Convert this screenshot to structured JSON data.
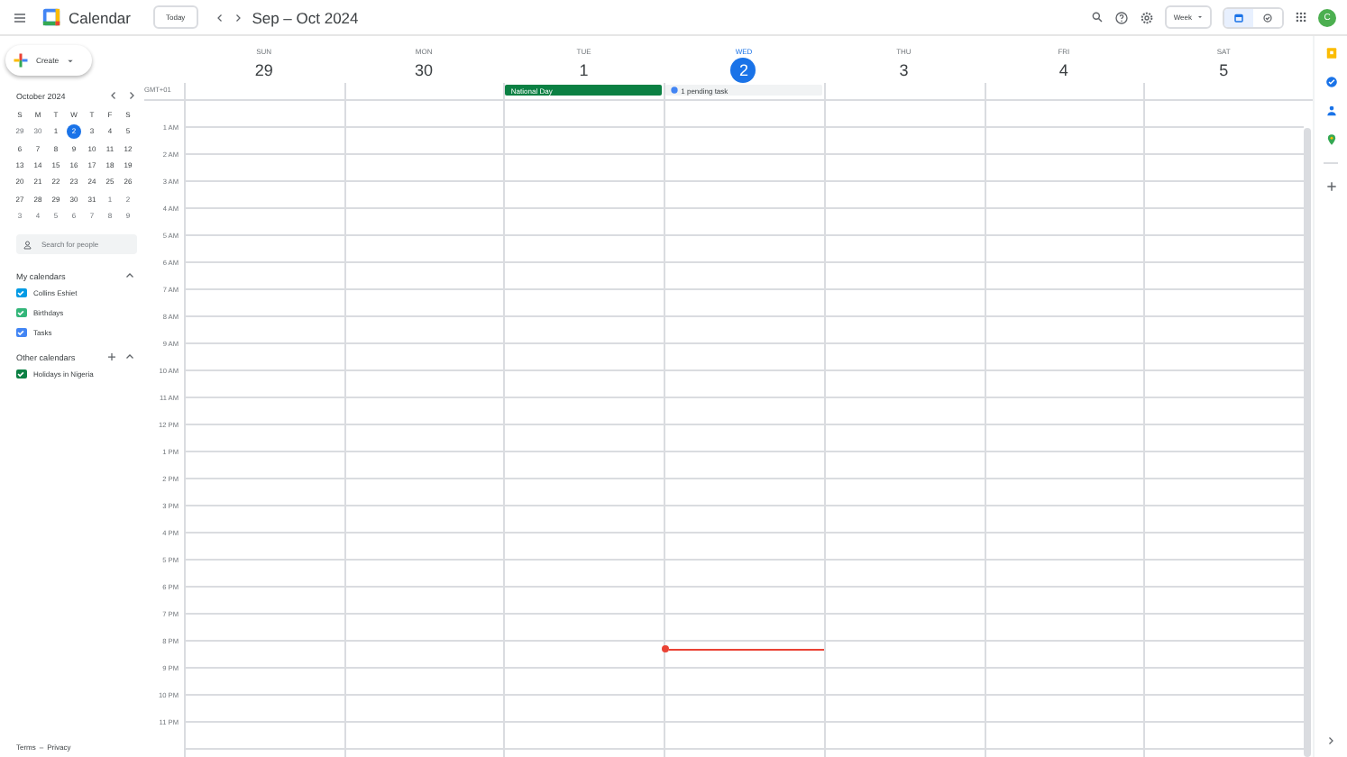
{
  "header": {
    "app_name": "Calendar",
    "today_button": "Today",
    "title": "Sep – Oct 2024",
    "view_select": "Week",
    "view_toggle": [
      {
        "kind": "calendar",
        "selected": true
      },
      {
        "kind": "tasks",
        "selected": false
      }
    ],
    "avatar": "C"
  },
  "sidebar": {
    "create_button": "Create",
    "mini_calendar": {
      "month": "October 2024",
      "weekdays": [
        "S",
        "M",
        "T",
        "W",
        "T",
        "F",
        "S"
      ],
      "weeks": [
        [
          {
            "day": "29",
            "other_month": true,
            "selected": false
          },
          {
            "day": "30",
            "other_month": true,
            "selected": false
          },
          {
            "day": "1",
            "other_month": false,
            "selected": false
          },
          {
            "day": "2",
            "other_month": false,
            "selected": true
          },
          {
            "day": "3",
            "other_month": false,
            "selected": false
          },
          {
            "day": "4",
            "other_month": false,
            "selected": false
          },
          {
            "day": "5",
            "other_month": false,
            "selected": false
          }
        ],
        [
          {
            "day": "6",
            "other_month": false,
            "selected": false
          },
          {
            "day": "7",
            "other_month": false,
            "selected": false
          },
          {
            "day": "8",
            "other_month": false,
            "selected": false
          },
          {
            "day": "9",
            "other_month": false,
            "selected": false
          },
          {
            "day": "10",
            "other_month": false,
            "selected": false
          },
          {
            "day": "11",
            "other_month": false,
            "selected": false
          },
          {
            "day": "12",
            "other_month": false,
            "selected": false
          }
        ],
        [
          {
            "day": "13",
            "other_month": false,
            "selected": false
          },
          {
            "day": "14",
            "other_month": false,
            "selected": false
          },
          {
            "day": "15",
            "other_month": false,
            "selected": false
          },
          {
            "day": "16",
            "other_month": false,
            "selected": false
          },
          {
            "day": "17",
            "other_month": false,
            "selected": false
          },
          {
            "day": "18",
            "other_month": false,
            "selected": false
          },
          {
            "day": "19",
            "other_month": false,
            "selected": false
          }
        ],
        [
          {
            "day": "20",
            "other_month": false,
            "selected": false
          },
          {
            "day": "21",
            "other_month": false,
            "selected": false
          },
          {
            "day": "22",
            "other_month": false,
            "selected": false
          },
          {
            "day": "23",
            "other_month": false,
            "selected": false
          },
          {
            "day": "24",
            "other_month": false,
            "selected": false
          },
          {
            "day": "25",
            "other_month": false,
            "selected": false
          },
          {
            "day": "26",
            "other_month": false,
            "selected": false
          }
        ],
        [
          {
            "day": "27",
            "other_month": false,
            "selected": false
          },
          {
            "day": "28",
            "other_month": false,
            "selected": false
          },
          {
            "day": "29",
            "other_month": false,
            "selected": false
          },
          {
            "day": "30",
            "other_month": false,
            "selected": false
          },
          {
            "day": "31",
            "other_month": false,
            "selected": false
          },
          {
            "day": "1",
            "other_month": true,
            "selected": false
          },
          {
            "day": "2",
            "other_month": true,
            "selected": false
          }
        ],
        [
          {
            "day": "3",
            "other_month": true,
            "selected": false
          },
          {
            "day": "4",
            "other_month": true,
            "selected": false
          },
          {
            "day": "5",
            "other_month": true,
            "selected": false
          },
          {
            "day": "6",
            "other_month": true,
            "selected": false
          },
          {
            "day": "7",
            "other_month": true,
            "selected": false
          },
          {
            "day": "8",
            "other_month": true,
            "selected": false
          },
          {
            "day": "9",
            "other_month": true,
            "selected": false
          }
        ]
      ]
    },
    "search_people": {
      "placeholder": "Search for people"
    },
    "my_calendars": {
      "title": "My calendars",
      "items": [
        {
          "label": "Collins Eshiet",
          "checked": true,
          "color": "#039be5"
        },
        {
          "label": "Birthdays",
          "checked": true,
          "color": "#33b679"
        },
        {
          "label": "Tasks",
          "checked": true,
          "color": "#4285f4"
        }
      ]
    },
    "other_calendars": {
      "title": "Other calendars",
      "items": [
        {
          "label": "Holidays in Nigeria",
          "checked": true,
          "color": "#0b8043"
        }
      ]
    },
    "footer": {
      "terms": "Terms",
      "separator": "–",
      "privacy": "Privacy"
    }
  },
  "week": {
    "timezone": "GMT+01",
    "days": [
      {
        "weekday": "SUN",
        "date": "29",
        "selected": false
      },
      {
        "weekday": "MON",
        "date": "30",
        "selected": false
      },
      {
        "weekday": "TUE",
        "date": "1",
        "selected": false,
        "all_day": [
          {
            "kind": "event",
            "title": "National Day",
            "color": "#0b8043"
          }
        ]
      },
      {
        "weekday": "WED",
        "date": "2",
        "selected": true,
        "all_day": [
          {
            "kind": "task",
            "title": "1 pending task",
            "color": "#4285f4"
          }
        ]
      },
      {
        "weekday": "THU",
        "date": "3",
        "selected": false
      },
      {
        "weekday": "FRI",
        "date": "4",
        "selected": false
      },
      {
        "weekday": "SAT",
        "date": "5",
        "selected": false
      }
    ],
    "hours": [
      "1 AM",
      "2 AM",
      "3 AM",
      "4 AM",
      "5 AM",
      "6 AM",
      "7 AM",
      "8 AM",
      "9 AM",
      "10 AM",
      "11 AM",
      "12 PM",
      "1 PM",
      "2 PM",
      "3 PM",
      "4 PM",
      "5 PM",
      "6 PM",
      "7 PM",
      "8 PM",
      "9 PM",
      "10 PM",
      "11 PM"
    ]
  }
}
